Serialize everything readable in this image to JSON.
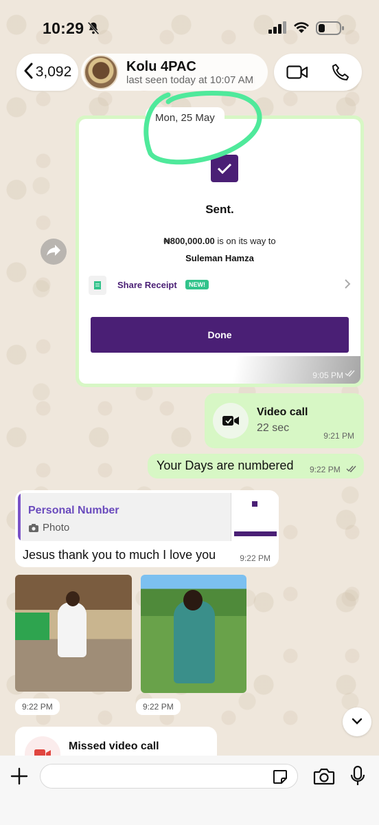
{
  "status_bar": {
    "time": "10:29"
  },
  "header": {
    "back_count": "3,092",
    "contact_name": "Kolu 4PAC",
    "last_seen": "last seen today at 10:07 AM"
  },
  "date_chip": "Mon, 25 May",
  "receipt_message": {
    "sent_title": "Sent.",
    "amount": "₦800,000.00",
    "amount_suffix": " is on its way to",
    "recipient": "Suleman Hamza",
    "share_label": "Share Receipt",
    "new_badge": "NEW!",
    "done_label": "Done",
    "time": "9:05 PM"
  },
  "video_call_message": {
    "title": "Video call",
    "duration": "22 sec",
    "time": "9:21 PM"
  },
  "text_message_out": {
    "text": "Your Days are numbered",
    "time": "9:22 PM"
  },
  "reply_message": {
    "quote_name": "Personal Number",
    "quote_type": "Photo",
    "text": "Jesus thank you to much I love you",
    "time": "9:22 PM"
  },
  "photo_messages": [
    {
      "time": "9:22 PM"
    },
    {
      "time": "9:22 PM"
    }
  ],
  "missed_call_message": {
    "title": "Missed video call"
  },
  "composer": {
    "value": ""
  },
  "colors": {
    "outgoing_bubble": "#d7f7c5",
    "incoming_bubble": "#ffffff",
    "wallpaper": "#efe7dc",
    "receipt_accent": "#4a1f75",
    "annotation_circle": "#4fe99b",
    "quote_name": "#6a4bbd"
  },
  "icons": [
    "bell-slash-icon",
    "signal-icon",
    "wifi-icon",
    "battery-icon",
    "back-chevron-icon",
    "video-camera-icon",
    "phone-icon",
    "forward-icon",
    "check-icon",
    "receipt-icon",
    "chevron-right-icon",
    "double-check-icon",
    "camera-small-icon",
    "chevron-down-icon",
    "plus-icon",
    "sticker-icon",
    "camera-icon",
    "microphone-icon"
  ]
}
